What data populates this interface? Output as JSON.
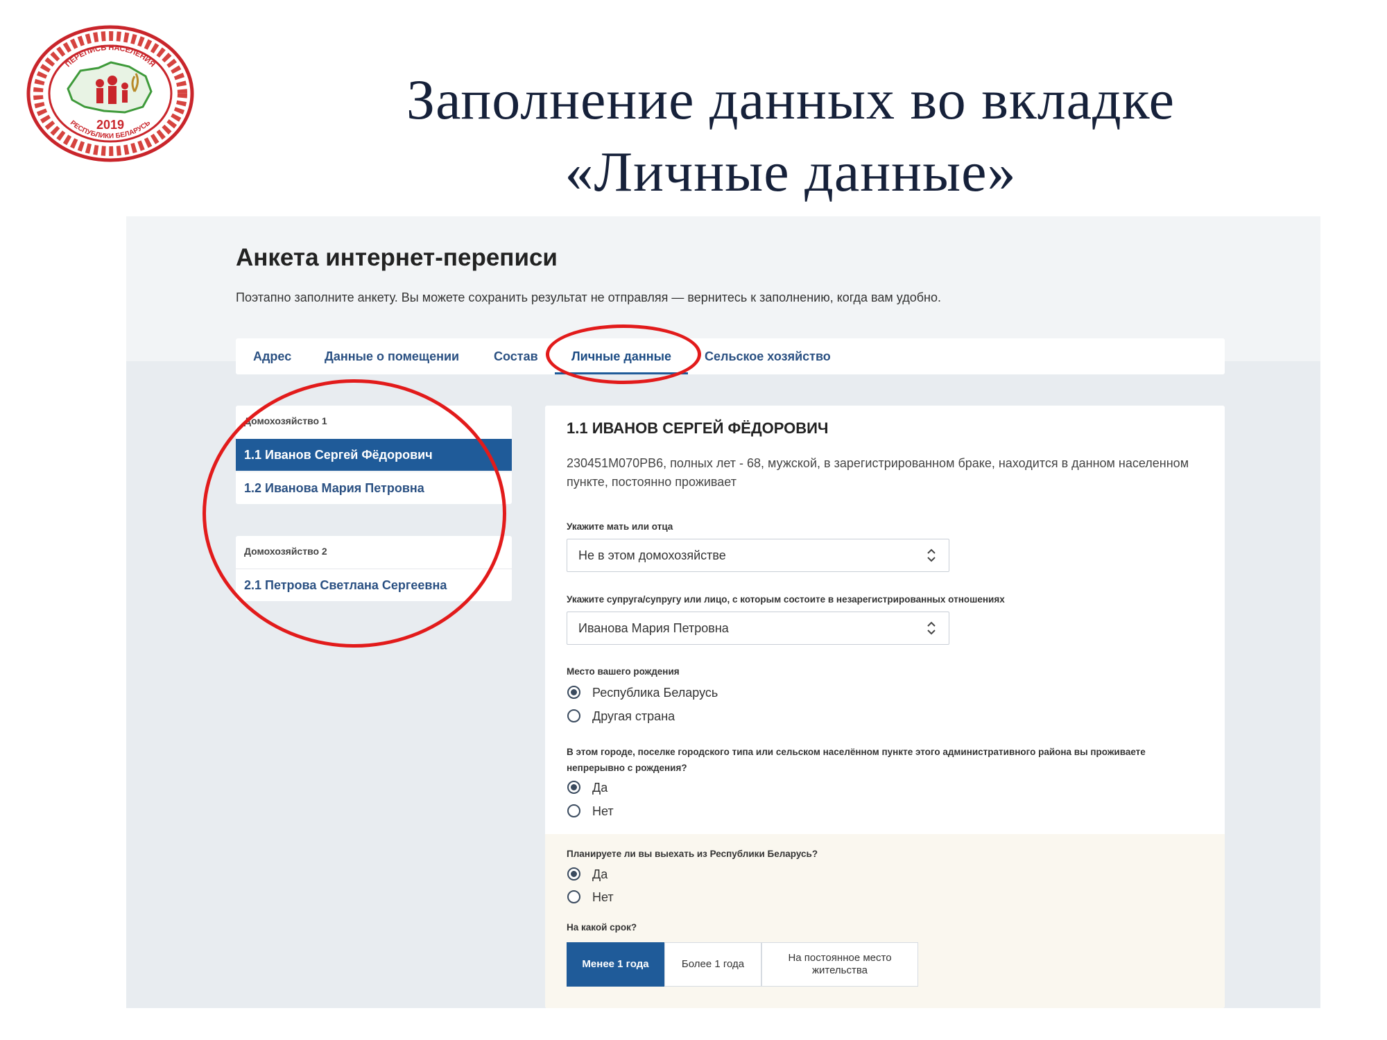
{
  "slide": {
    "title_line1": "Заполнение данных во вкладке",
    "title_line2": "«Личные данные»",
    "logo": {
      "icon": "census-2019-logo-icon",
      "text_top": "ПЕРЕПИСЬ НАСЕЛЕНИЯ",
      "year": "2019",
      "text_bottom": "РЕСПУБЛИКИ БЕЛАРУСЬ",
      "colors": {
        "ring": "#c9252b",
        "ornament": "#d6433f",
        "map": "#3e9a3a"
      }
    }
  },
  "form": {
    "title": "Анкета интернет-переписи",
    "subtitle": "Поэтапно заполните анкету. Вы можете сохранить результат не отправляя — вернитесь к заполнению, когда вам удобно."
  },
  "tabs": [
    {
      "label": "Адрес",
      "active": false
    },
    {
      "label": "Данные о помещении",
      "active": false
    },
    {
      "label": "Состав",
      "active": false
    },
    {
      "label": "Личные данные",
      "active": true
    },
    {
      "label": "Сельское хозяйство",
      "active": false
    }
  ],
  "households": [
    {
      "label": "Домохозяйство 1",
      "members": [
        {
          "label": "1.1  Иванов Сергей Фёдорович",
          "selected": true
        },
        {
          "label": "1.2  Иванова Мария Петровна",
          "selected": false
        }
      ]
    },
    {
      "label": "Домохозяйство 2",
      "members": [
        {
          "label": "2.1  Петрова Светлана Сергеевна",
          "selected": false
        }
      ]
    }
  ],
  "person": {
    "title": "1.1 ИВАНОВ СЕРГЕЙ ФЁДОРОВИЧ",
    "description": "230451М070РВ6, полных лет - 68, мужской, в зарегистрированном браке, находится в данном населенном пункте, постоянно проживает"
  },
  "questions": {
    "parent": {
      "label": "Укажите мать или отца",
      "value": "Не в этом домохозяйстве"
    },
    "spouse": {
      "label": "Укажите супруга/супругу или лицо, с которым состоите в незарегистрированных отношениях",
      "value": "Иванова Мария  Петровна"
    },
    "birthplace": {
      "label": "Место вашего рождения",
      "options": [
        "Республика Беларусь",
        "Другая страна"
      ],
      "selected": 0
    },
    "since_birth": {
      "label": "В этом городе, поселке городского типа или сельском населённом пункте этого административного района вы проживаете непрерывно с рождения?",
      "options": [
        "Да",
        "Нет"
      ],
      "selected": 0
    },
    "plan_leave": {
      "label": "Планируете ли вы выехать из Республики Беларусь?",
      "options": [
        "Да",
        "Нет"
      ],
      "selected": 0
    },
    "term": {
      "label": "На какой срок?",
      "options": [
        "Менее 1 года",
        "Более 1 года",
        "На постоянное место жительства"
      ],
      "selected": 0
    }
  },
  "colors": {
    "accent": "#1f5b99",
    "link": "#2a5082",
    "annotation": "#e21b1b",
    "cream": "#faf7ef"
  }
}
